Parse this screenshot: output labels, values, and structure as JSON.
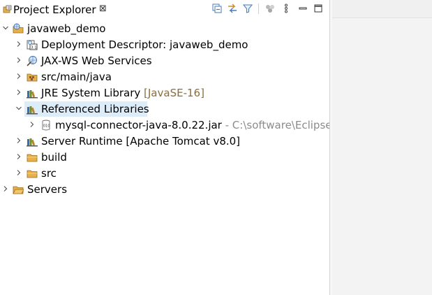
{
  "view": {
    "title": "Project Explorer",
    "close_glyph": "⊠",
    "toolbar_icons": [
      "collapse-all-icon",
      "link-with-editor-icon",
      "filter-icon",
      "focus-icon",
      "view-menu-icon",
      "minimize-icon",
      "maximize-icon"
    ]
  },
  "tree": {
    "project": "javaweb_demo",
    "deployment": "Deployment Descriptor: javaweb_demo",
    "jaxws": "JAX-WS Web Services",
    "src_main": "src/main/java",
    "jre": "JRE System Library",
    "jre_deco": "[JavaSE-16]",
    "ref_libs": "Referenced Libraries",
    "jar": "mysql-connector-java-8.0.22.jar",
    "jar_deco": "- C:\\software\\Eclipse\\j",
    "server_runtime": "Server Runtime [Apache Tomcat v8.0]",
    "build": "build",
    "src": "src",
    "servers": "Servers"
  },
  "colors": {
    "selection": "#dcecf9",
    "decoration_brown": "#8a6d3b",
    "decoration_gray": "#8c8c8c",
    "folder": "#e8b04a"
  }
}
